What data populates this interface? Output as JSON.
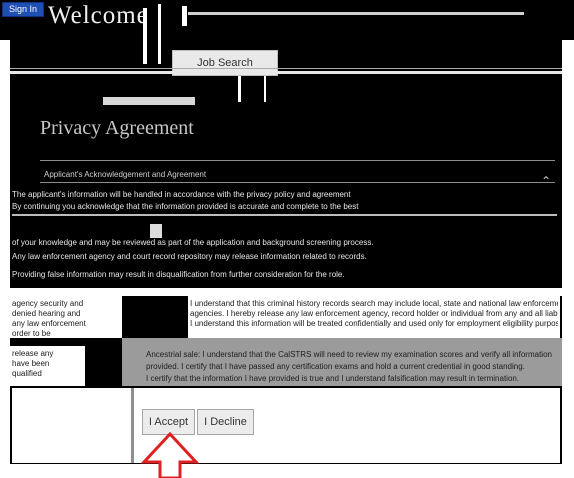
{
  "header": {
    "sign_in_label": "Sign In",
    "welcome_text": "Welcome"
  },
  "nav": {
    "job_search_tab": "Job Search"
  },
  "page": {
    "title": "Privacy Agreement",
    "section_heading": "Applicant's Acknowledgement and Agreement"
  },
  "body_lines": [
    "The applicant's information will be handled in accordance with the privacy policy and agreement",
    "By continuing you acknowledge that the information provided is accurate and complete to the best",
    "of your knowledge and may be reviewed as part of the application and background screening process.",
    "Any law enforcement agency and court record repository may release information related to records.",
    "Providing false information may result in disqualification from further consideration for the role."
  ],
  "left_column_lines": [
    "agency security and",
    "denied hearing and",
    "any law enforcement",
    "order to be",
    "release any",
    "have been",
    "qualified"
  ],
  "consent_lines": [
    "I understand that this criminal history records search may include local, state and national law enforcement",
    "agencies. I hereby release any law enforcement agency, record holder or individual from any and all liability",
    "I understand this information will be treated confidentially and used only for employment eligibility purposes."
  ],
  "ack_lines": [
    "Ancestrial sale: I understand that the CalSTRS will need to review my examination scores and verify all information",
    "provided. I certify that I have passed any certification exams and hold a current credential in good standing.",
    "I certify that the information I have provided is true and I understand falsification may result in termination."
  ],
  "actions": {
    "accept_label": "I Accept",
    "decline_label": "I Decline"
  },
  "colors": {
    "sign_in_button": "#1f4fb3",
    "arrow": "#e02020",
    "background_dark": "#000000"
  }
}
